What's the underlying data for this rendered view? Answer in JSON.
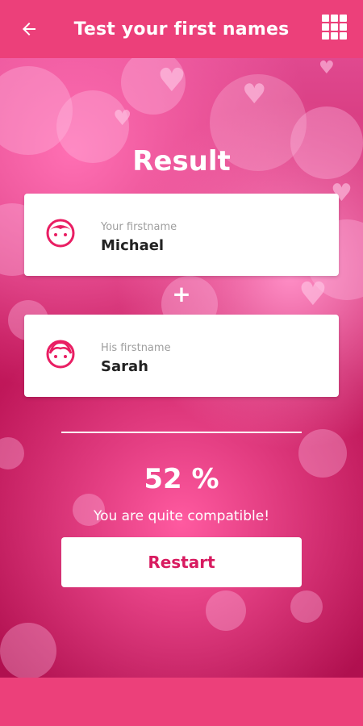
{
  "header": {
    "title": "Test your first names",
    "back_icon": "arrow-left-icon",
    "menu_icon": "grid-icon"
  },
  "result": {
    "heading": "Result",
    "first": {
      "label": "Your firstname",
      "name": "Michael",
      "icon": "boy-face-icon"
    },
    "plus": "+",
    "second": {
      "label": "His firstname",
      "name": "Sarah",
      "icon": "girl-face-icon"
    },
    "percent": "52 %",
    "message": "You are quite compatible!",
    "restart_label": "Restart"
  },
  "colors": {
    "primary": "#ec407a",
    "accent": "#d81b60",
    "card": "#ffffff"
  }
}
